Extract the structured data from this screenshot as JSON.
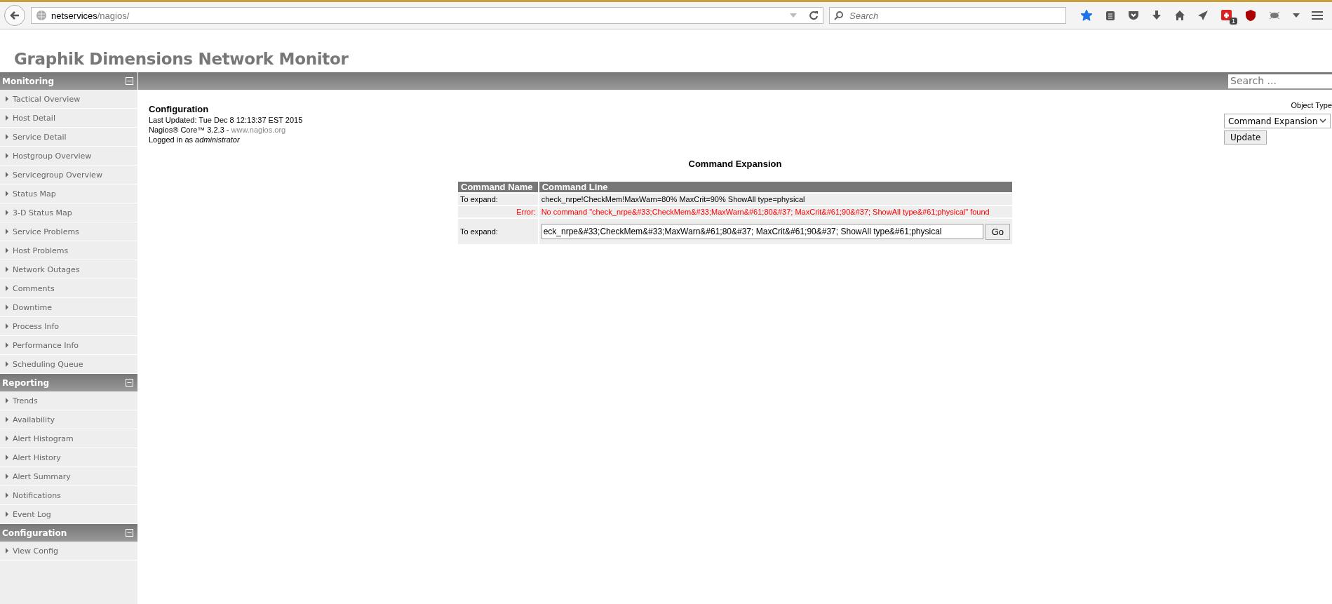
{
  "browser": {
    "url_host": "netservices",
    "url_path": "/nagios/",
    "search_placeholder": "Search",
    "bookmarked": true,
    "extension_badge": "1"
  },
  "header": {
    "title": "Graphik Dimensions Network Monitor"
  },
  "sidebar": {
    "sections": [
      {
        "title": "Monitoring",
        "expanded": true,
        "items": [
          "Tactical Overview",
          "Host Detail",
          "Service Detail",
          "Hostgroup Overview",
          "Servicegroup Overview",
          "Status Map",
          "3-D Status Map",
          "Service Problems",
          "Host Problems",
          "Network Outages",
          "Comments",
          "Downtime",
          "Process Info",
          "Performance Info",
          "Scheduling Queue"
        ]
      },
      {
        "title": "Reporting",
        "expanded": true,
        "items": [
          "Trends",
          "Availability",
          "Alert Histogram",
          "Alert History",
          "Alert Summary",
          "Notifications",
          "Event Log"
        ]
      },
      {
        "title": "Configuration",
        "expanded": true,
        "items": [
          "View Config"
        ]
      }
    ]
  },
  "topbar": {
    "search_placeholder": "Search ..."
  },
  "info": {
    "title": "Configuration",
    "updated": "Last Updated: Tue Dec 8 12:13:37 EST 2015",
    "version": "Nagios® Core™ 3.2.3 - ",
    "version_link": "www.nagios.org",
    "login": "Logged in as ",
    "user": "administrator"
  },
  "object_type": {
    "label": "Object Type",
    "value": "Command Expansion",
    "button": "Update"
  },
  "expansion": {
    "title": "Command Expansion",
    "columns": [
      "Command Name",
      "Command Line"
    ],
    "row_label": "To expand:",
    "row_value": "check_nrpe!CheckMem!MaxWarn=80% MaxCrit=90% ShowAll type=physical",
    "error_label": "Error:",
    "error_text": "No command \"check_nrpe&#33;CheckMem&#33;MaxWarn&#61;80&#37; MaxCrit&#61;90&#37; ShowAll type&#61;physical\" found",
    "input_label": "To expand:",
    "input_value": "eck_nrpe&#33;CheckMem&#33;MaxWarn&#61;80&#37; MaxCrit&#61;90&#37; ShowAll type&#61;physical",
    "button": "Go"
  }
}
